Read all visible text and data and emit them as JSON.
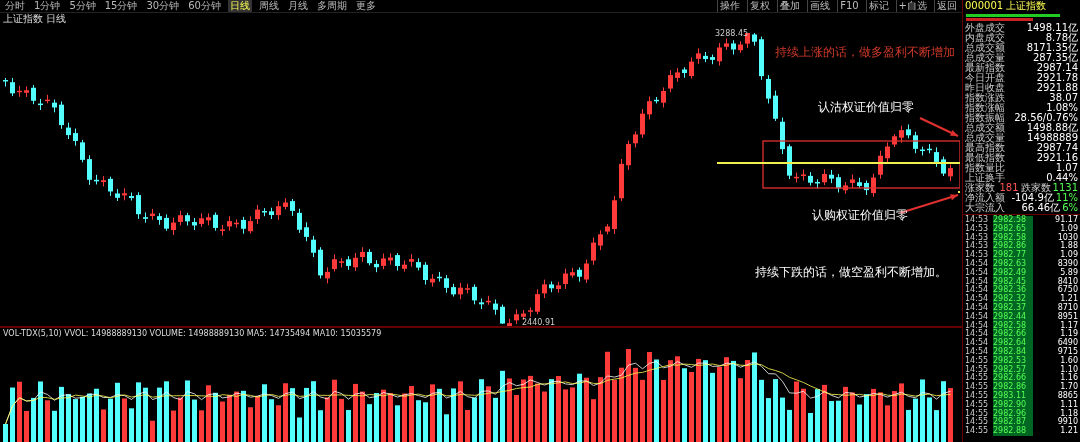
{
  "toolbar": {
    "periods": [
      {
        "label": "分时",
        "selected": false
      },
      {
        "label": "1分钟",
        "selected": false
      },
      {
        "label": "5分钟",
        "selected": false
      },
      {
        "label": "15分钟",
        "selected": false
      },
      {
        "label": "30分钟",
        "selected": false
      },
      {
        "label": "60分钟",
        "selected": false
      },
      {
        "label": "日线",
        "selected": true
      },
      {
        "label": "周线",
        "selected": false
      },
      {
        "label": "月线",
        "selected": false
      },
      {
        "label": "多周期",
        "selected": false
      },
      {
        "label": "更多",
        "selected": false
      }
    ],
    "tools": [
      "操作",
      "复权",
      "叠加",
      "画线",
      "F10",
      "标记",
      "+自选",
      "返回"
    ]
  },
  "chart": {
    "title": "上证指数 日线",
    "high_label": "3288.45",
    "low_label": "2440.91",
    "annotations": [
      {
        "text": "持续上涨的话，做多盈利不断增加",
        "kind": "bullish"
      },
      {
        "text": "认沽权证价值归零",
        "kind": "note"
      },
      {
        "text": "认购权证价值归零",
        "kind": "note"
      },
      {
        "text": "持续下跌的话，做空盈利不断增加。",
        "kind": "bearish"
      }
    ]
  },
  "volume": {
    "legend": "VOL-TDX(5,10) VVOL: 14988889130 VOLUME: 14988889130 MA5: 14735494 MA10: 15035579"
  },
  "quote_panel": {
    "title": "000001 上证指数",
    "stats": [
      {
        "cells": [
          "外盘成交",
          "1498.11亿"
        ]
      },
      {
        "cells": [
          "内盘成交",
          "8.78亿"
        ]
      },
      {
        "cells": [
          "总成交额",
          "8171.35亿"
        ]
      },
      {
        "cells": [
          "总成交量",
          "287.35亿"
        ]
      },
      {
        "cells": [
          "最新指数",
          "2987.14"
        ]
      },
      {
        "cells": [
          "今日开盘",
          "2921.78"
        ]
      },
      {
        "cells": [
          "昨日收盘",
          "2921.88"
        ]
      },
      {
        "cells": [
          "指数涨跌",
          "38.07"
        ]
      },
      {
        "cells": [
          "指数涨幅",
          "1.08%"
        ]
      },
      {
        "cells": [
          "指数振幅",
          "28.56/0.76%"
        ]
      },
      {
        "cells": [
          "总成交额",
          "1498.88亿"
        ]
      },
      {
        "cells": [
          "总成交量",
          "14988889"
        ]
      },
      {
        "cells": [
          "最高指数",
          "2987.74"
        ]
      },
      {
        "cells": [
          "最低指数",
          "2921.16"
        ]
      },
      {
        "cells": [
          "指数量比",
          "1.07"
        ]
      },
      {
        "cells": [
          "上证换手",
          "0.44%"
        ]
      },
      {
        "cells": [
          "涨家数",
          "181",
          "跌家数",
          "1131"
        ]
      },
      {
        "cells": [
          "净流入额",
          "-104.9亿",
          "11%"
        ]
      },
      {
        "cells": [
          "大宗流入",
          "66.46亿",
          "6%"
        ]
      }
    ],
    "trades": [
      {
        "time": "14:53",
        "price": "2982.58",
        "volume": "91.17"
      },
      {
        "time": "14:53",
        "price": "2982.65",
        "volume": "1.09"
      },
      {
        "time": "14:53",
        "price": "2982.58",
        "volume": "1030"
      },
      {
        "time": "14:53",
        "price": "2982.86",
        "volume": "1.88"
      },
      {
        "time": "14:53",
        "price": "2982.77",
        "volume": "1.09"
      },
      {
        "time": "14:54",
        "price": "2982.63",
        "volume": "8390"
      },
      {
        "time": "14:54",
        "price": "2982.49",
        "volume": "5.89"
      },
      {
        "time": "14:54",
        "price": "2982.45",
        "volume": "8410"
      },
      {
        "time": "14:54",
        "price": "2982.36",
        "volume": "6750"
      },
      {
        "time": "14:54",
        "price": "2982.32",
        "volume": "1.21"
      },
      {
        "time": "14:54",
        "price": "2982.37",
        "volume": "8710"
      },
      {
        "time": "14:54",
        "price": "2982.44",
        "volume": "8951"
      },
      {
        "time": "14:54",
        "price": "2982.58",
        "volume": "1.17"
      },
      {
        "time": "14:54",
        "price": "2982.66",
        "volume": "1.19"
      },
      {
        "time": "14:54",
        "price": "2982.64",
        "volume": "6490"
      },
      {
        "time": "14:54",
        "price": "2982.84",
        "volume": "9715"
      },
      {
        "time": "14:55",
        "price": "2982.53",
        "volume": "1.60"
      },
      {
        "time": "14:55",
        "price": "2982.57",
        "volume": "1.10"
      },
      {
        "time": "14:55",
        "price": "2982.66",
        "volume": "1.16"
      },
      {
        "time": "14:55",
        "price": "2982.86",
        "volume": "1.70"
      },
      {
        "time": "14:55",
        "price": "2983.11",
        "volume": "8865"
      },
      {
        "time": "14:55",
        "price": "2982.90",
        "volume": "1.11"
      },
      {
        "time": "14:55",
        "price": "2982.96",
        "volume": "1.18"
      },
      {
        "time": "14:55",
        "price": "2982.87",
        "volume": "9910"
      },
      {
        "time": "14:55",
        "price": "2982.88",
        "volume": "1.21"
      }
    ]
  }
}
